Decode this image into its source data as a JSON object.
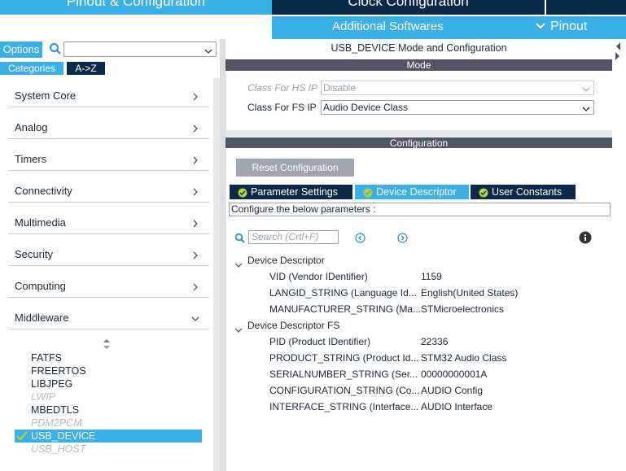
{
  "top_tabs": {
    "pinout_config": "Pinout & Configuration",
    "clock_config": "Clock Configuration"
  },
  "sub_bar": {
    "additional_softwares": "Additional Softwares",
    "pinout": "Pinout"
  },
  "left": {
    "options": "Options",
    "search_placeholder": "",
    "tab_categories": "Categories",
    "tab_az": "A->Z",
    "categories": [
      {
        "label": "System Core"
      },
      {
        "label": "Analog"
      },
      {
        "label": "Timers"
      },
      {
        "label": "Connectivity"
      },
      {
        "label": "Multimedia"
      },
      {
        "label": "Security"
      },
      {
        "label": "Computing"
      },
      {
        "label": "Middleware"
      }
    ],
    "middleware_items": [
      {
        "label": "FATFS",
        "state": "normal"
      },
      {
        "label": "FREERTOS",
        "state": "normal"
      },
      {
        "label": "LIBJPEG",
        "state": "normal"
      },
      {
        "label": "LWIP",
        "state": "disabled"
      },
      {
        "label": "MBEDTLS",
        "state": "normal"
      },
      {
        "label": "PDM2PCM",
        "state": "disabled"
      },
      {
        "label": "USB_DEVICE",
        "state": "selected"
      },
      {
        "label": "USB_HOST",
        "state": "disabled"
      }
    ]
  },
  "right": {
    "title": "USB_DEVICE Mode and Configuration",
    "mode_header": "Mode",
    "hs_label": "Class For HS IP",
    "hs_value": "Disable",
    "fs_label": "Class For FS IP",
    "fs_value": "Audio Device Class",
    "config_header": "Configuration",
    "reset_button": "Reset Configuration",
    "tabs": {
      "parameter_settings": "Parameter Settings",
      "device_descriptor": "Device Descriptor",
      "user_constants": "User Constants"
    },
    "hint": "Configure the below parameters :",
    "search_placeholder": "Search (Crtl+F)",
    "groups": [
      {
        "name": "Device Descriptor",
        "params": [
          {
            "name": "VID (Vendor IDentifier)",
            "value": "1159"
          },
          {
            "name": "LANGID_STRING (Language Id...",
            "value": "English(United States)"
          },
          {
            "name": "MANUFACTURER_STRING (Ma...",
            "value": "STMicroelectronics"
          }
        ]
      },
      {
        "name": "Device Descriptor FS",
        "params": [
          {
            "name": "PID (Product IDentifier)",
            "value": "22336"
          },
          {
            "name": "PRODUCT_STRING (Product Id...",
            "value": "STM32 Audio Class"
          },
          {
            "name": "SERIALNUMBER_STRING (Ser...",
            "value": "00000000001A"
          },
          {
            "name": "CONFIGURATION_STRING (Co...",
            "value": "AUDIO Config"
          },
          {
            "name": "INTERFACE_STRING (Interface...",
            "value": "AUDIO Interface"
          }
        ]
      }
    ]
  },
  "colors": {
    "accent_blue": "#3bb0e6",
    "dark_navy": "#0b2a4a",
    "section_gray": "#4d5761",
    "check_green": "#b5d334"
  }
}
